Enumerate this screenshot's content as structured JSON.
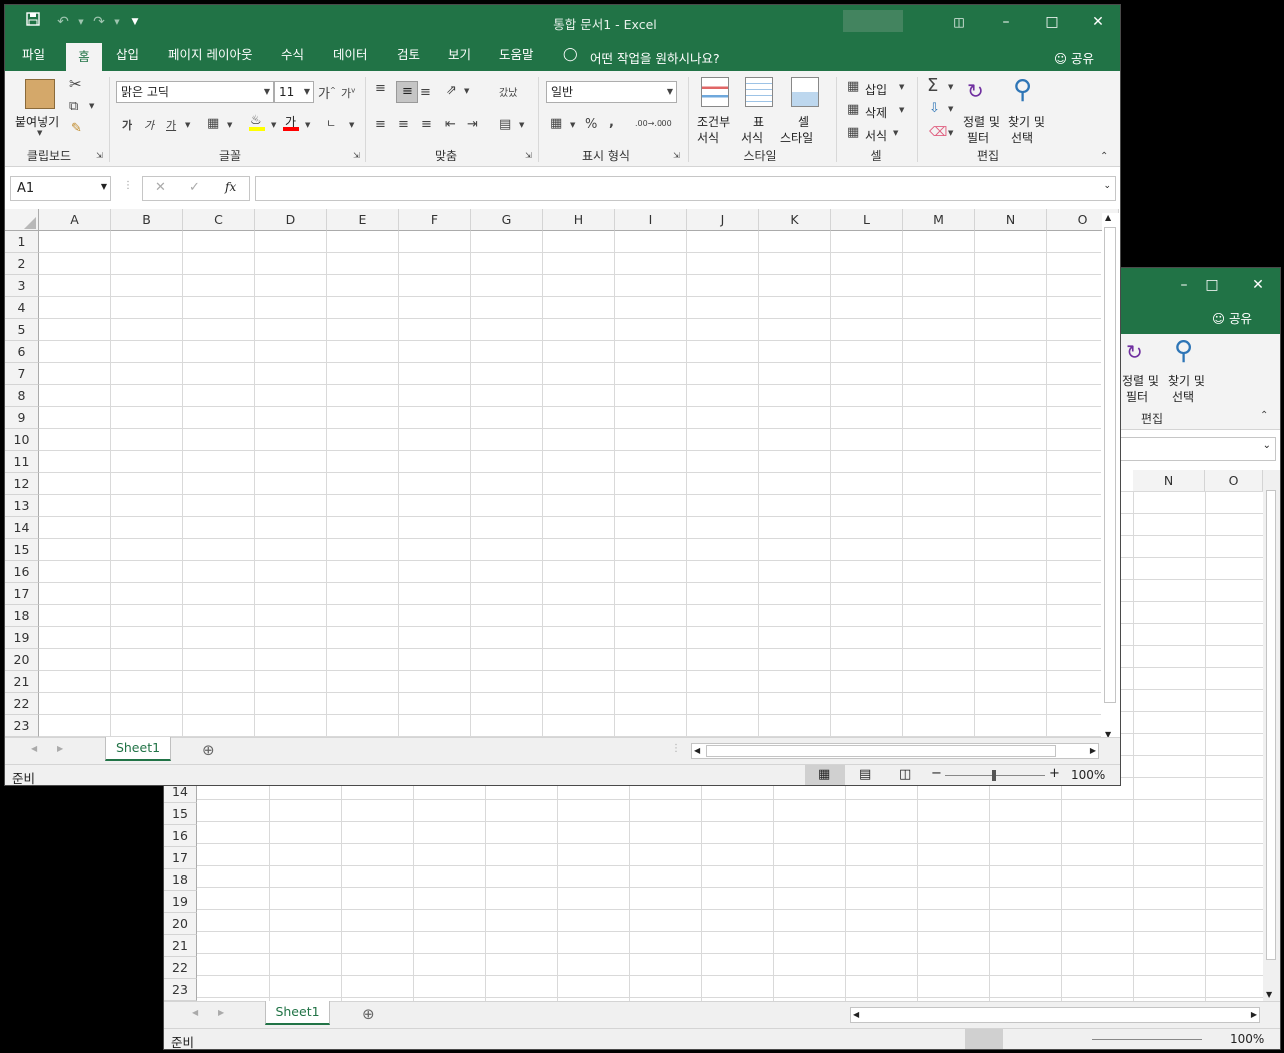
{
  "front": {
    "title": "통합 문서1  -  Excel",
    "tabs": [
      "파일",
      "홈",
      "삽입",
      "페이지 레이아웃",
      "수식",
      "데이터",
      "검토",
      "보기",
      "도움말"
    ],
    "tell_me": "어떤 작업을 원하시나요?",
    "share": "공유",
    "clipboard": {
      "paste": "붙여넣기",
      "label": "클립보드"
    },
    "font": {
      "name": "맑은 고딕",
      "size": "11",
      "label": "글꼴",
      "bold": "가",
      "italic": "가",
      "underline": "가",
      "font_color": "가"
    },
    "alignment": {
      "wrap": "갔났",
      "merge": "내쳐",
      "label": "맞춤"
    },
    "number": {
      "format": "일반",
      "percent": "%",
      "comma": ",",
      "inc_decimal": ".00→.0",
      "dec_decimal": ".00",
      "label": "표시 형식"
    },
    "styles": {
      "conditional_1": "조건부",
      "conditional_2": "서식",
      "table_1": "표",
      "table_2": "서식",
      "cell_1": "셀",
      "cell_2": "스타일",
      "label": "스타일"
    },
    "cells": {
      "insert": "삽입",
      "delete": "삭제",
      "format": "서식",
      "label": "셀"
    },
    "editing": {
      "sort_1": "정렬 및",
      "sort_2": "필터",
      "find_1": "찾기 및",
      "find_2": "선택",
      "label": "편집"
    },
    "name_box": "A1",
    "fx": "fx",
    "columns": [
      "A",
      "B",
      "C",
      "D",
      "E",
      "F",
      "G",
      "H",
      "I",
      "J",
      "K",
      "L",
      "M",
      "N",
      "O"
    ],
    "rows": [
      "1",
      "2",
      "3",
      "4",
      "5",
      "6",
      "7",
      "8",
      "9",
      "10",
      "11",
      "12",
      "13",
      "14",
      "15",
      "16",
      "17",
      "18",
      "19",
      "20",
      "21",
      "22",
      "23"
    ],
    "sheet": "Sheet1",
    "status": "준비",
    "zoom": "100%"
  },
  "back": {
    "share": "공유",
    "editing": {
      "sort_1": "정렬 및",
      "sort_2": "필터",
      "find_1": "찾기 및",
      "find_2": "선택",
      "label": "편집"
    },
    "columns": [
      "N",
      "O"
    ],
    "rows": [
      "14",
      "15",
      "16",
      "17",
      "18",
      "19",
      "20",
      "21",
      "22",
      "23"
    ],
    "sheet": "Sheet1",
    "status": "준비",
    "zoom": "100%"
  },
  "colors": {
    "accent": "#217346",
    "ribbon": "#f3f3f3",
    "grid": "#d9d9d9"
  }
}
